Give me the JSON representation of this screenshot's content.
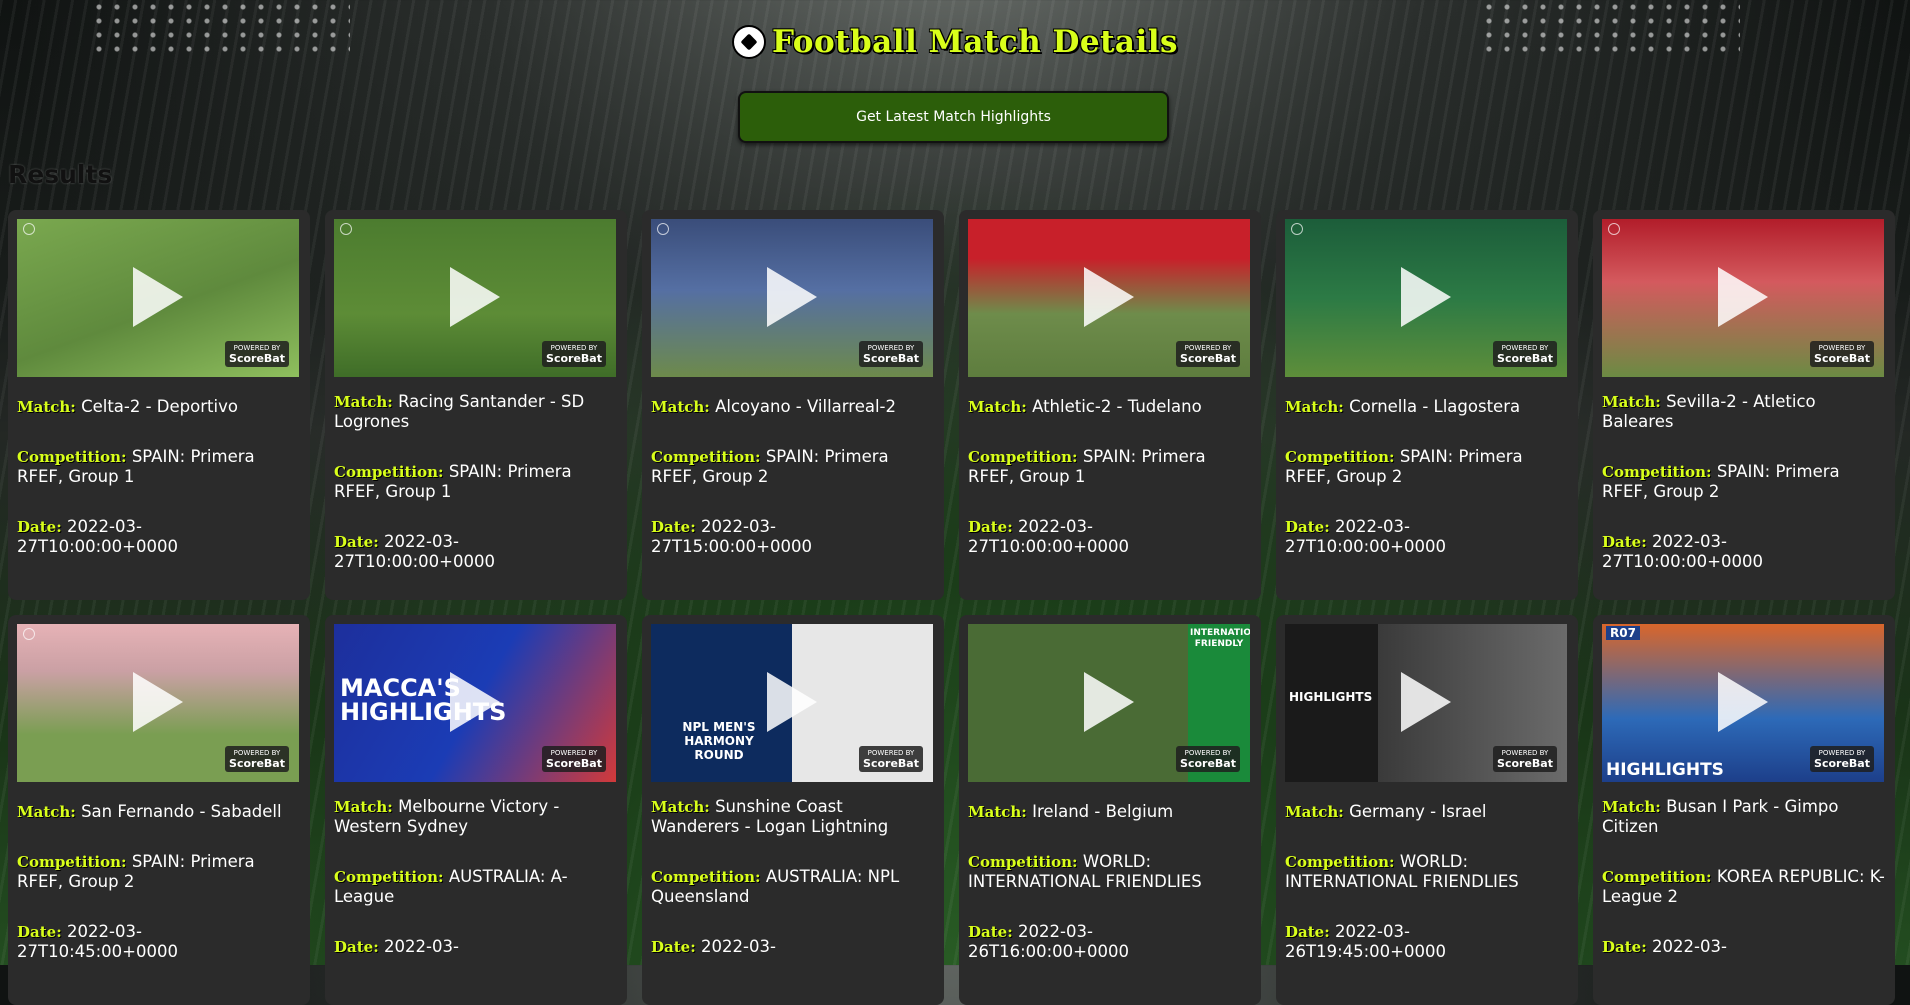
{
  "header": {
    "title": "Football Match Details",
    "button_label": "Get Latest Match Highlights"
  },
  "results_heading": "Results",
  "labels": {
    "match": "Match:",
    "competition": "Competition:",
    "date": "Date:"
  },
  "thumb_badge": {
    "top": "POWERED BY",
    "brand": "ScoreBat"
  },
  "cards": [
    {
      "match": "Celta-2 - Deportivo",
      "competition": "SPAIN: Primera RFEF, Group 1",
      "date": "2022-03-27T10:00:00+0000"
    },
    {
      "match": "Racing Santander - SD Logrones",
      "competition": "SPAIN: Primera RFEF, Group 1",
      "date": "2022-03-27T10:00:00+0000"
    },
    {
      "match": "Alcoyano - Villarreal-2",
      "competition": "SPAIN: Primera RFEF, Group 2",
      "date": "2022-03-27T15:00:00+0000"
    },
    {
      "match": "Athletic-2 - Tudelano",
      "competition": "SPAIN: Primera RFEF, Group 1",
      "date": "2022-03-27T10:00:00+0000"
    },
    {
      "match": "Cornella - Llagostera",
      "competition": "SPAIN: Primera RFEF, Group 2",
      "date": "2022-03-27T10:00:00+0000"
    },
    {
      "match": "Sevilla-2 - Atletico Baleares",
      "competition": "SPAIN: Primera RFEF, Group 2",
      "date": "2022-03-27T10:00:00+0000"
    },
    {
      "match": "San Fernando - Sabadell",
      "competition": "SPAIN: Primera RFEF, Group 2",
      "date": "2022-03-27T10:45:00+0000"
    },
    {
      "match": "Melbourne Victory - Western Sydney",
      "competition": "AUSTRALIA: A-League",
      "date": "2022-03-"
    },
    {
      "match": "Sunshine Coast Wanderers - Logan Lightning",
      "competition": "AUSTRALIA: NPL Queensland",
      "date": "2022-03-"
    },
    {
      "match": "Ireland - Belgium",
      "competition": "WORLD: INTERNATIONAL FRIENDLIES",
      "date": "2022-03-26T16:00:00+0000"
    },
    {
      "match": "Germany - Israel",
      "competition": "WORLD: INTERNATIONAL FRIENDLIES",
      "date": "2022-03-26T19:45:00+0000"
    },
    {
      "match": "Busan I Park - Gimpo Citizen",
      "competition": "KOREA REPUBLIC: K-League 2",
      "date": "2022-03-"
    }
  ],
  "thumb_texts": {
    "maccas": "MACCA'S HIGHLIGHTS",
    "npl": "NPL MEN'S HARMONY ROUND",
    "highlights": "HIGHLIGHTS",
    "friendly": "INTERNATIONAL FRIENDLY",
    "r07": "R07"
  }
}
